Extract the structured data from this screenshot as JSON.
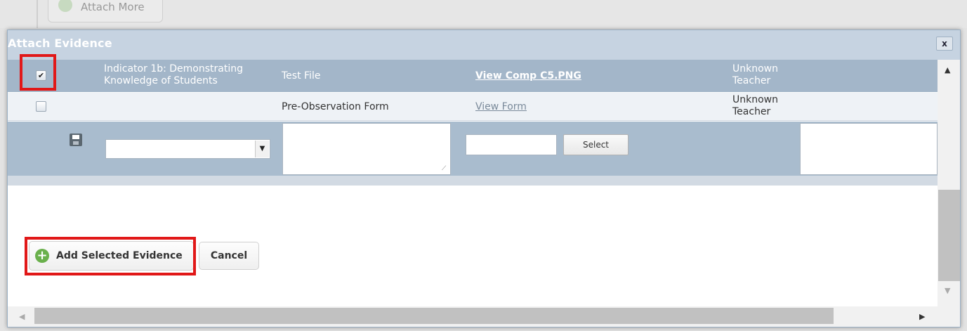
{
  "background": {
    "attach_more_label": "Attach More"
  },
  "dialog": {
    "title": "Attach Evidence",
    "close_label": "x"
  },
  "rows": [
    {
      "checked": "✔",
      "indicator": "Indicator 1b: Demonstrating Knowledge of Students",
      "title": "Test File",
      "link": "View Comp C5.PNG",
      "owner": "Unknown Teacher"
    },
    {
      "checked": "",
      "indicator": "",
      "title": "Pre-Observation Form",
      "link": "View Form",
      "owner": "Unknown Teacher"
    }
  ],
  "new_row": {
    "select_value": "",
    "description_value": "",
    "file_value": "",
    "select_button_label": "Select"
  },
  "buttons": {
    "add_selected_label": "Add Selected Evidence",
    "cancel_label": "Cancel"
  },
  "colors": {
    "title_bar": "#c6d3e1",
    "selected_row": "#a3b6c9",
    "highlight": "#e11818",
    "add_icon": "#6ab04c"
  },
  "icons": {
    "save": "floppy-disk-icon",
    "add": "plus-circle-icon",
    "close": "close-icon"
  }
}
